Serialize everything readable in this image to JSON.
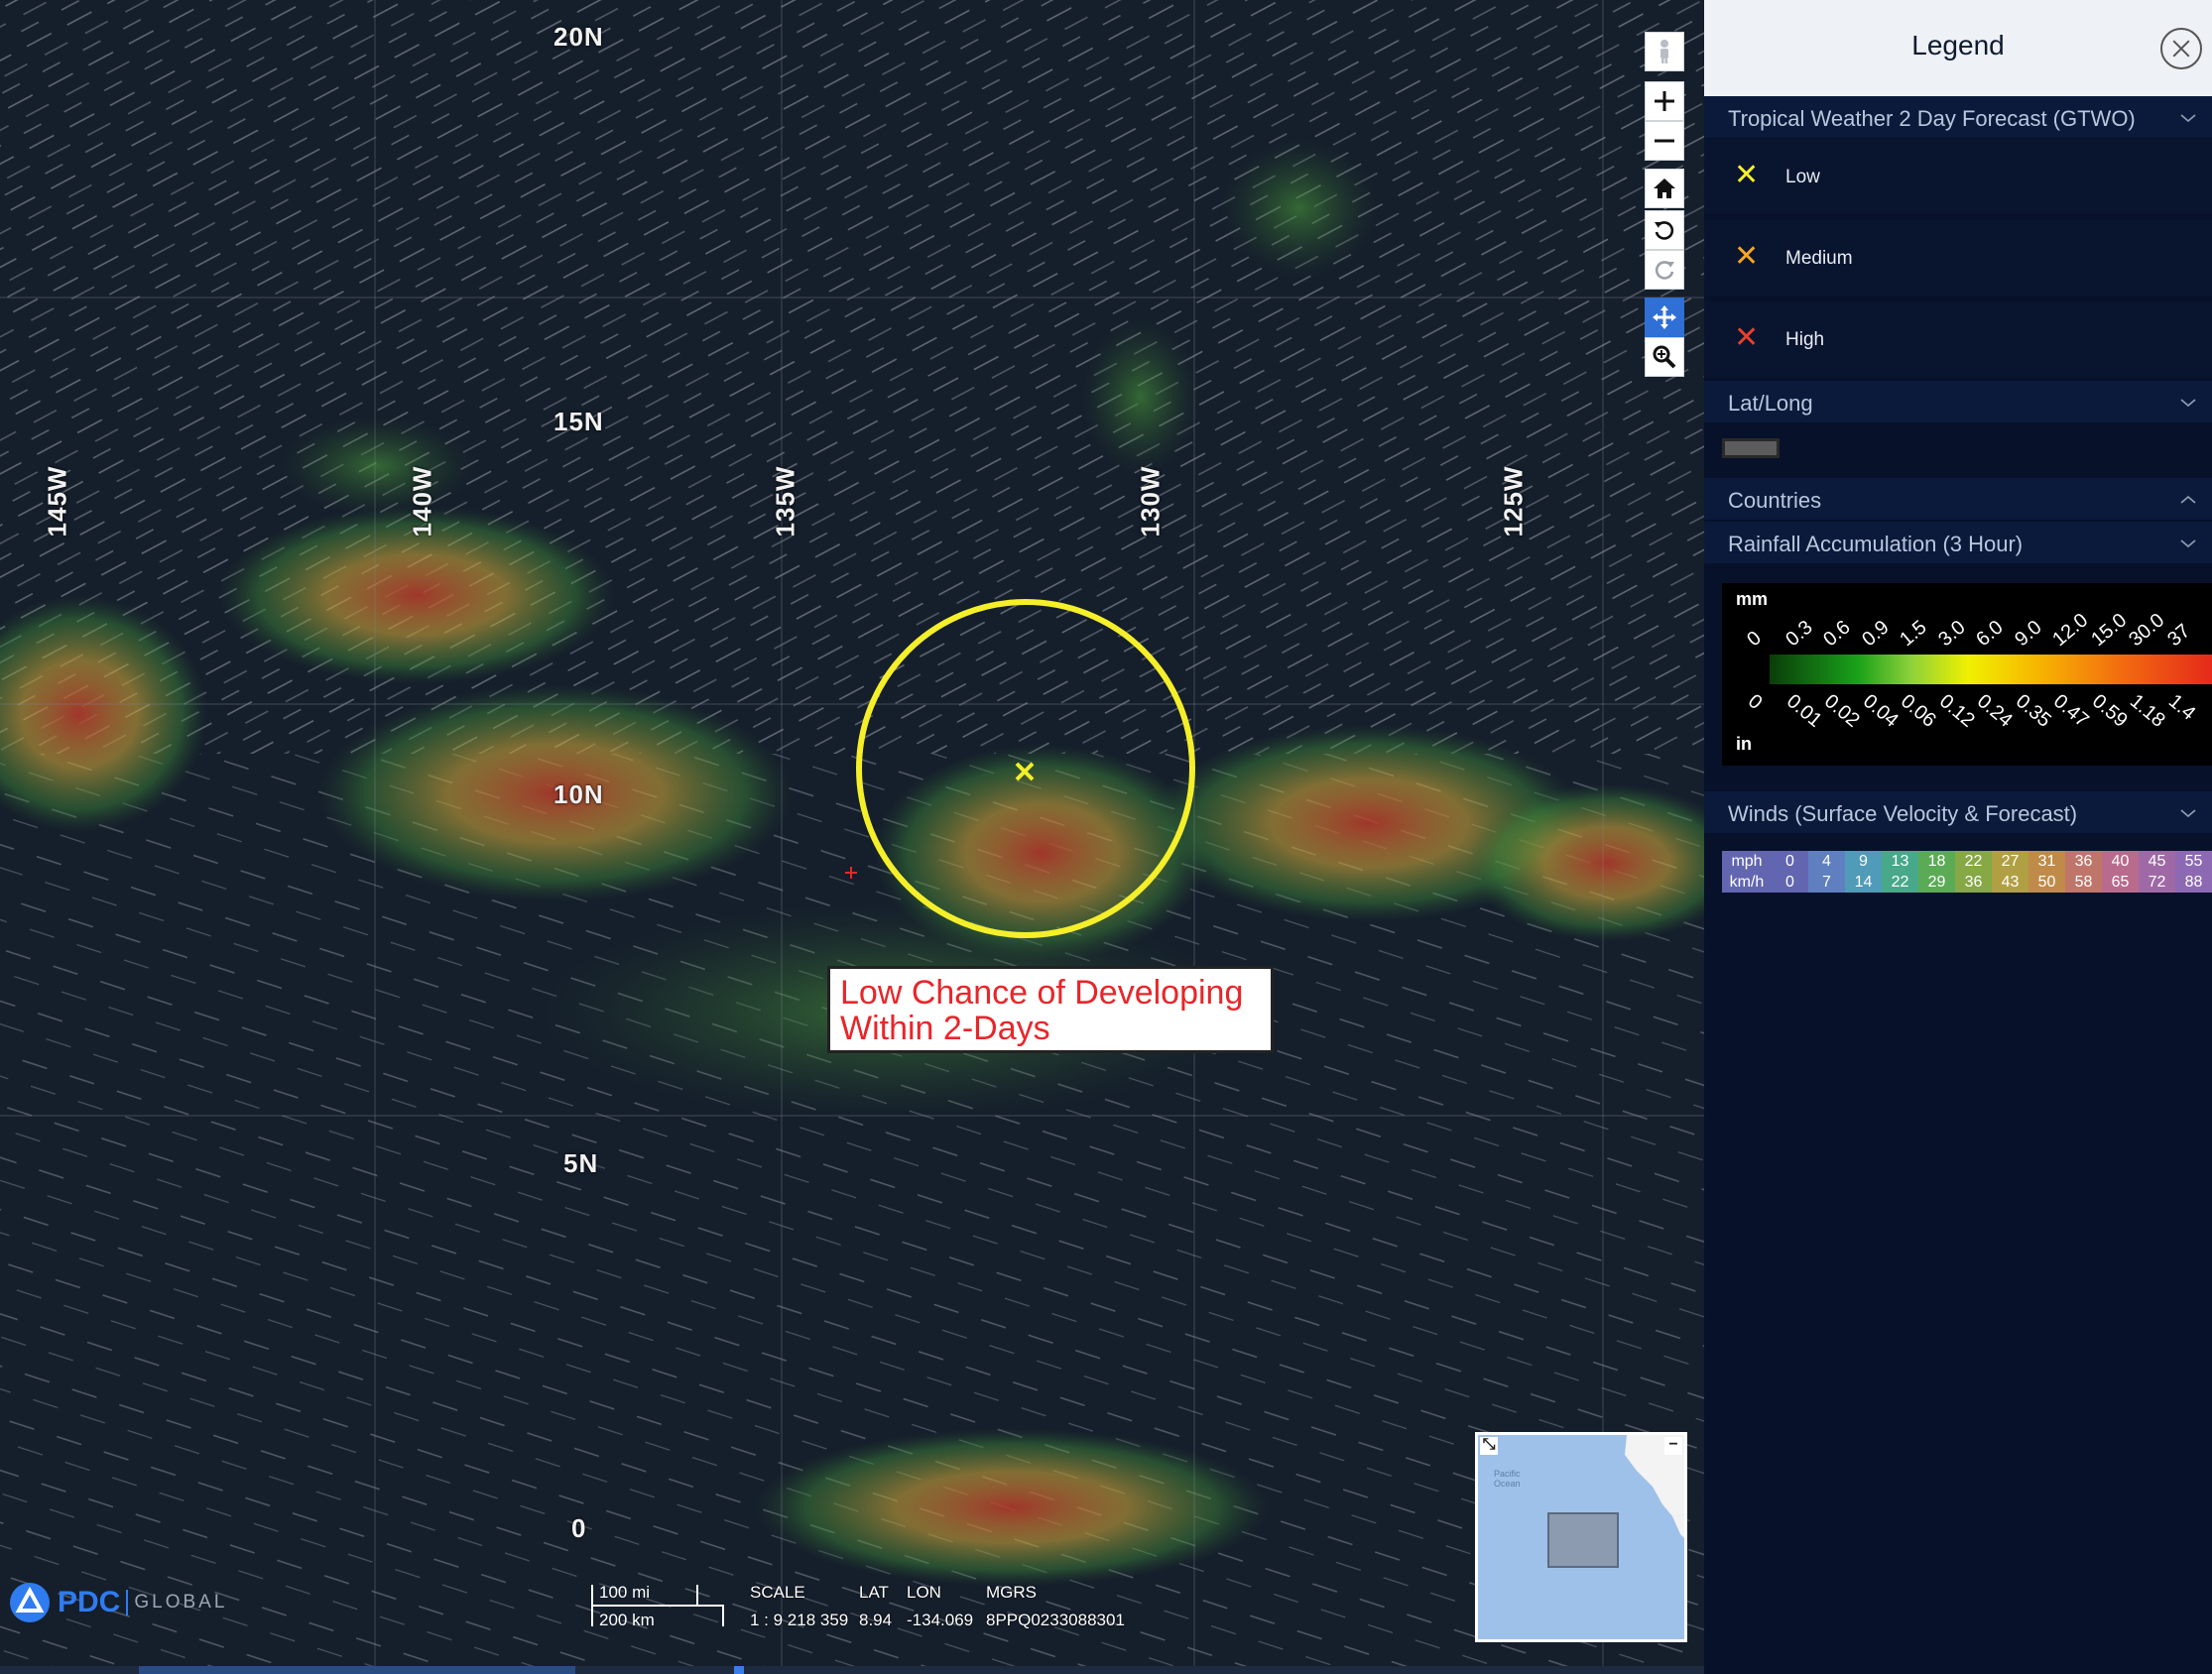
{
  "map": {
    "lat_labels": [
      "20N",
      "15N",
      "10N",
      "5N",
      "0"
    ],
    "lon_labels": [
      "145W",
      "140W",
      "135W",
      "130W",
      "125W"
    ],
    "callout": {
      "line1": "Low Chance of Developing",
      "line2": "Within 2-Days"
    },
    "disturbance_color": "#f5ef2a",
    "tools": [
      {
        "name": "street-view-icon"
      },
      {
        "name": "zoom-in-icon"
      },
      {
        "name": "zoom-out-icon"
      },
      {
        "name": "home-icon"
      },
      {
        "name": "rotate-left-icon"
      },
      {
        "name": "rotate-right-icon"
      },
      {
        "name": "pan-icon",
        "active": true
      },
      {
        "name": "zoom-box-icon"
      }
    ],
    "overview": {
      "label": "Pacific Ocean"
    },
    "logo": {
      "brand": "PDC",
      "sub": "GLOBAL"
    },
    "scale": {
      "mi": "100 mi",
      "km": "200 km"
    },
    "readouts": {
      "scale_label": "SCALE",
      "scale_value": "1 : 9 218 359",
      "lat_label": "LAT",
      "lat_value": "8.94",
      "lon_label": "LON",
      "lon_value": "-134.069",
      "mgrs_label": "MGRS",
      "mgrs_value": "8PPQ0233088301"
    }
  },
  "legend": {
    "title": "Legend",
    "gtwo": {
      "title": "Tropical Weather 2 Day Forecast (GTWO)",
      "items": [
        {
          "label": "Low",
          "color": "#f5ef2a"
        },
        {
          "label": "Medium",
          "color": "#f5a623"
        },
        {
          "label": "High",
          "color": "#e8402a"
        }
      ]
    },
    "latlong": {
      "title": "Lat/Long"
    },
    "countries": {
      "title": "Countries"
    },
    "rainfall": {
      "title": "Rainfall Accumulation (3 Hour)",
      "unit_top": "mm",
      "unit_bottom": "in",
      "mm_ticks": [
        "0",
        "0.3",
        "0.6",
        "0.9",
        "1.5",
        "3.0",
        "6.0",
        "9.0",
        "12.0",
        "15.0",
        "30.0",
        "37"
      ],
      "in_ticks": [
        "0",
        "0.01",
        "0.02",
        "0.04",
        "0.06",
        "0.12",
        "0.24",
        "0.35",
        "0.47",
        "0.59",
        "1.18",
        "1.4"
      ]
    },
    "winds": {
      "title": "Winds (Surface Velocity & Forecast)",
      "mph_label": "mph",
      "kmh_label": "km/h",
      "mph": [
        "0",
        "4",
        "9",
        "13",
        "18",
        "22",
        "27",
        "31",
        "36",
        "40",
        "45",
        "55"
      ],
      "kmh": [
        "0",
        "7",
        "14",
        "22",
        "29",
        "36",
        "43",
        "50",
        "58",
        "65",
        "72",
        "88"
      ],
      "colors": [
        "#6266b0",
        "#5f7fc0",
        "#4f9bb8",
        "#47a88a",
        "#5bab56",
        "#86a845",
        "#b0a043",
        "#c08b48",
        "#c0756a",
        "#b86b8d",
        "#9f69a6",
        "#8d69b3"
      ]
    }
  }
}
